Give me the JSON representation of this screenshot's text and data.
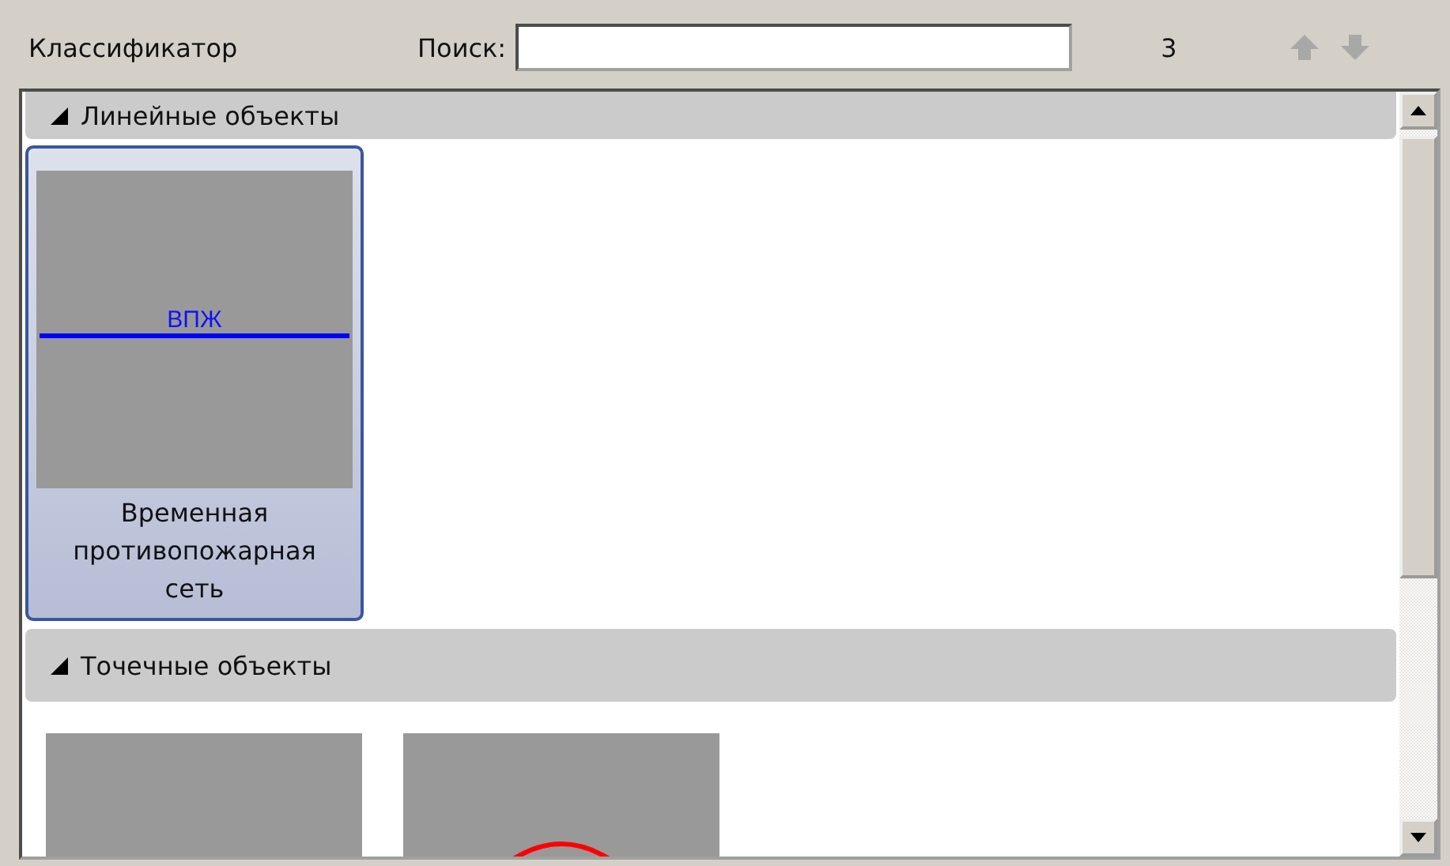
{
  "toolbar": {
    "title": "Классификатор",
    "search_label": "Поиск:",
    "count": "3"
  },
  "groups": [
    {
      "title": "Линейные объекты",
      "expanded": true,
      "items": [
        {
          "kind": "line",
          "symbol_text": "ВПЖ",
          "label": "Временная противопожарная сеть",
          "selected": true
        }
      ]
    },
    {
      "title": "Точечные объекты",
      "expanded": true,
      "items": [
        {
          "kind": "blank",
          "selected": false
        },
        {
          "kind": "circle",
          "selected": false
        }
      ]
    }
  ]
}
